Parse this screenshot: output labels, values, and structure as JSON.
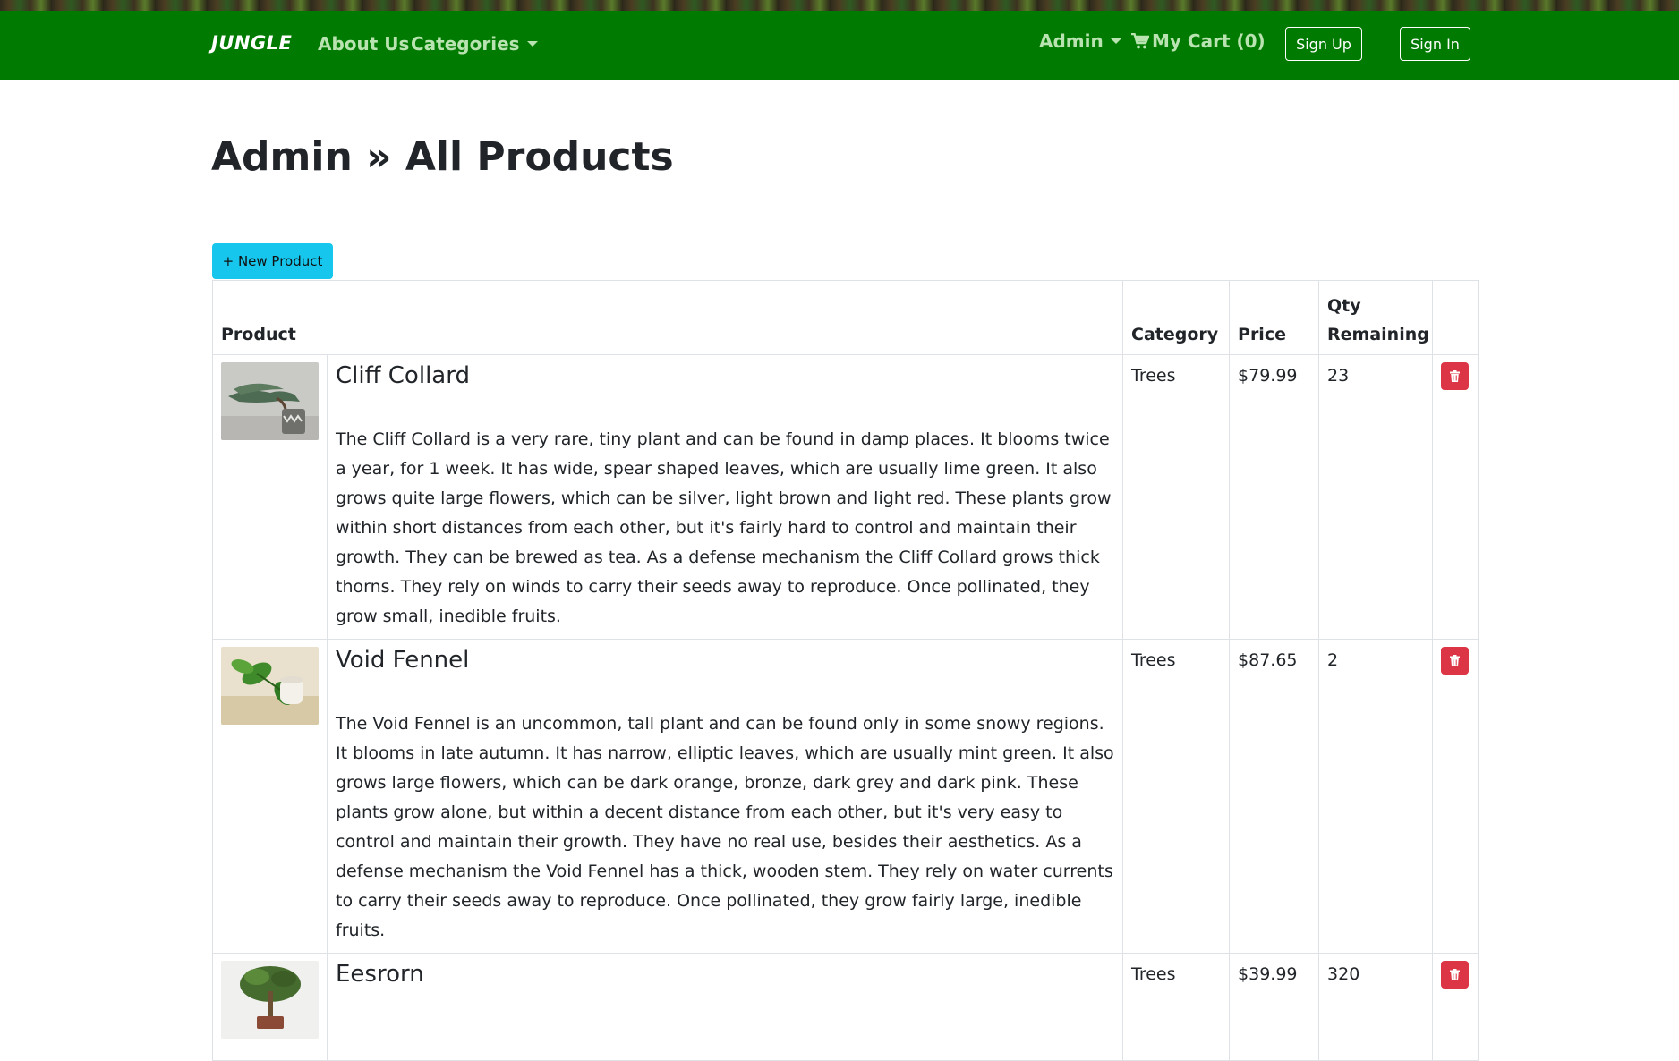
{
  "navbar": {
    "brand": "JUNGLE",
    "about": "About Us",
    "categories": "Categories",
    "admin": "Admin",
    "cart": "My Cart (0)",
    "signup": "Sign Up",
    "signin": "Sign In",
    "color": "#007a00"
  },
  "page": {
    "title": "Admin » All Products",
    "new_button": "+ New Product"
  },
  "table": {
    "headers": {
      "product": "Product",
      "category": "Category",
      "price": "Price",
      "qty": "Qty Remaining"
    },
    "rows": [
      {
        "name": "Cliff Collard",
        "description": "The Cliff Collard is a very rare, tiny plant and can be found in damp places. It blooms twice a year, for 1 week. It has wide, spear shaped leaves, which are usually lime green. It also grows quite large flowers, which can be silver, light brown and light red. These plants grow within short distances from each other, but it's fairly hard to control and maintain their growth. They can be brewed as tea. As a defense mechanism the Cliff Collard grows thick thorns. They rely on winds to carry their seeds away to reproduce. Once pollinated, they grow small, inedible fruits.",
        "category": "Trees",
        "price": "$79.99",
        "qty": "23"
      },
      {
        "name": "Void Fennel",
        "description": "The Void Fennel is an uncommon, tall plant and can be found only in some snowy regions. It blooms in late autumn. It has narrow, elliptic leaves, which are usually mint green. It also grows large flowers, which can be dark orange, bronze, dark grey and dark pink. These plants grow alone, but within a decent distance from each other, but it's very easy to control and maintain their growth. They have no real use, besides their aesthetics. As a defense mechanism the Void Fennel has a thick, wooden stem. They rely on water currents to carry their seeds away to reproduce. Once pollinated, they grow fairly large, inedible fruits.",
        "category": "Trees",
        "price": "$87.65",
        "qty": "2"
      },
      {
        "name": "Eesrorn",
        "description": "",
        "category": "Trees",
        "price": "$39.99",
        "qty": "320"
      }
    ]
  },
  "colors": {
    "new_button": "#17c6ec",
    "delete_button": "#dc3545"
  }
}
